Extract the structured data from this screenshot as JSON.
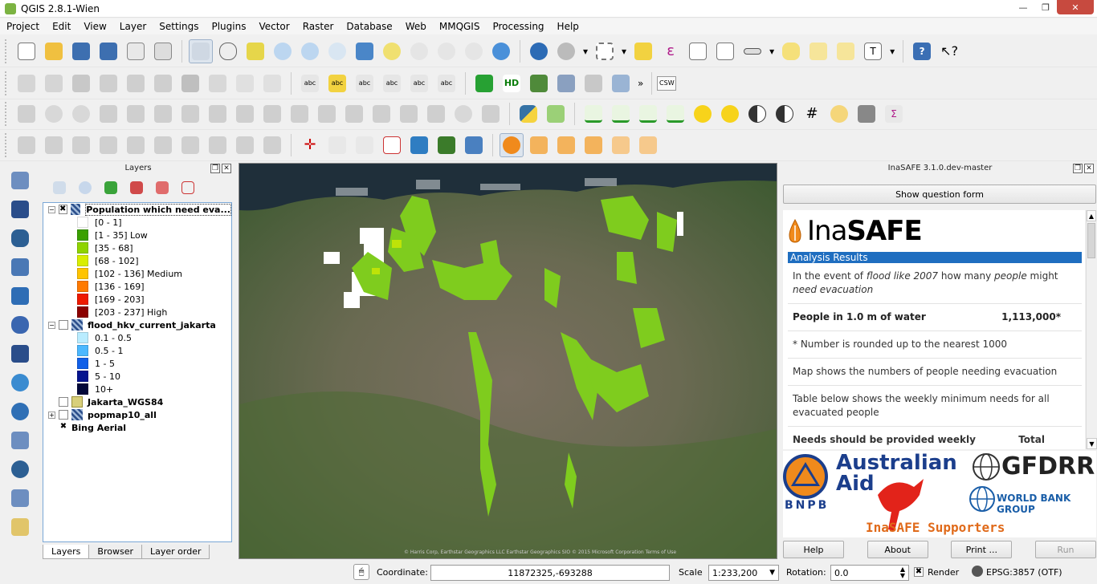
{
  "window": {
    "title": "QGIS 2.8.1-Wien",
    "minimize": "—",
    "maximize": "❐",
    "close": "✕"
  },
  "menu": [
    "Project",
    "Edit",
    "View",
    "Layer",
    "Settings",
    "Plugins",
    "Vector",
    "Raster",
    "Database",
    "Web",
    "MMQGIS",
    "Processing",
    "Help"
  ],
  "toolbar": {
    "csw_label": "CSW",
    "overflow": "»"
  },
  "layers_panel": {
    "title": "Layers",
    "tabs": [
      "Layers",
      "Browser",
      "Layer order"
    ],
    "items": [
      {
        "label": "Population which need eva...",
        "checked": "✖",
        "expander": "−"
      },
      {
        "legend": [
          {
            "label": "[0 - 1]",
            "color": "#ffffff"
          },
          {
            "label": "[1 - 35] Low",
            "color": "#3aa000"
          },
          {
            "label": "[35 - 68]",
            "color": "#8fd400"
          },
          {
            "label": "[68 - 102]",
            "color": "#d9ee00"
          },
          {
            "label": "[102 - 136] Medium",
            "color": "#ffc400"
          },
          {
            "label": "[136 - 169]",
            "color": "#ff7a00"
          },
          {
            "label": "[169 - 203]",
            "color": "#ee1a00"
          },
          {
            "label": "[203 - 237] High",
            "color": "#8b0000"
          }
        ]
      },
      {
        "label": "flood_hkv_current_jakarta",
        "checked": "",
        "expander": "−"
      },
      {
        "legend2": [
          {
            "label": "0.1 - 0.5",
            "color": "#b9ecff"
          },
          {
            "label": "0.5 - 1",
            "color": "#4cb8ff"
          },
          {
            "label": "1 - 5",
            "color": "#1160e8"
          },
          {
            "label": "5 - 10",
            "color": "#05148f"
          },
          {
            "label": "10+",
            "color": "#02083a"
          }
        ]
      },
      {
        "label": "Jakarta_WGS84",
        "checked": ""
      },
      {
        "label": "popmap10_all",
        "checked": "",
        "expander": "+"
      },
      {
        "label": "Bing Aerial",
        "checked": "✖"
      }
    ]
  },
  "map": {
    "attribution": "© Harris Corp, Earthstar Geographics LLC Earthstar Geographics SIO © 2015 Microsoft Corporation Terms of Use"
  },
  "inasafe": {
    "title": "InaSAFE 3.1.0.dev-master",
    "show_question": "Show question form",
    "brand_light": "Ina",
    "brand_bold": "SAFE",
    "results_title": "Analysis Results",
    "q_prefix": "In the event of ",
    "q_hazard": "flood like 2007",
    "q_mid": " how many ",
    "q_people": "people",
    "q_might": " might ",
    "q_need": "need evacuation",
    "people_label": "People in 1.0 m of water",
    "people_value": "1,113,000*",
    "note1": "* Number is rounded up to the nearest 1000",
    "note2": "Map shows the numbers of people needing evacuation",
    "note3": "Table below shows the weekly minimum needs for all evacuated people",
    "note4_left": "Needs should be provided weekly",
    "note4_right": "Total",
    "logos": {
      "bnpb": "BNPB",
      "aus1": "Australian",
      "aus2": "Aid",
      "gfdrr": "GFDRR",
      "wbg": "WORLD BANK GROUP",
      "supporters": "InaSAFE Supporters"
    },
    "buttons": {
      "help": "Help",
      "about": "About",
      "print": "Print ...",
      "run": "Run"
    }
  },
  "status": {
    "coordinate_label": "Coordinate:",
    "coordinate": "11872325,-693288",
    "scale_label": "Scale",
    "scale": "1:233,200",
    "rotation_label": "Rotation:",
    "rotation": "0.0",
    "render": "Render",
    "crs": "EPSG:3857 (OTF)"
  }
}
